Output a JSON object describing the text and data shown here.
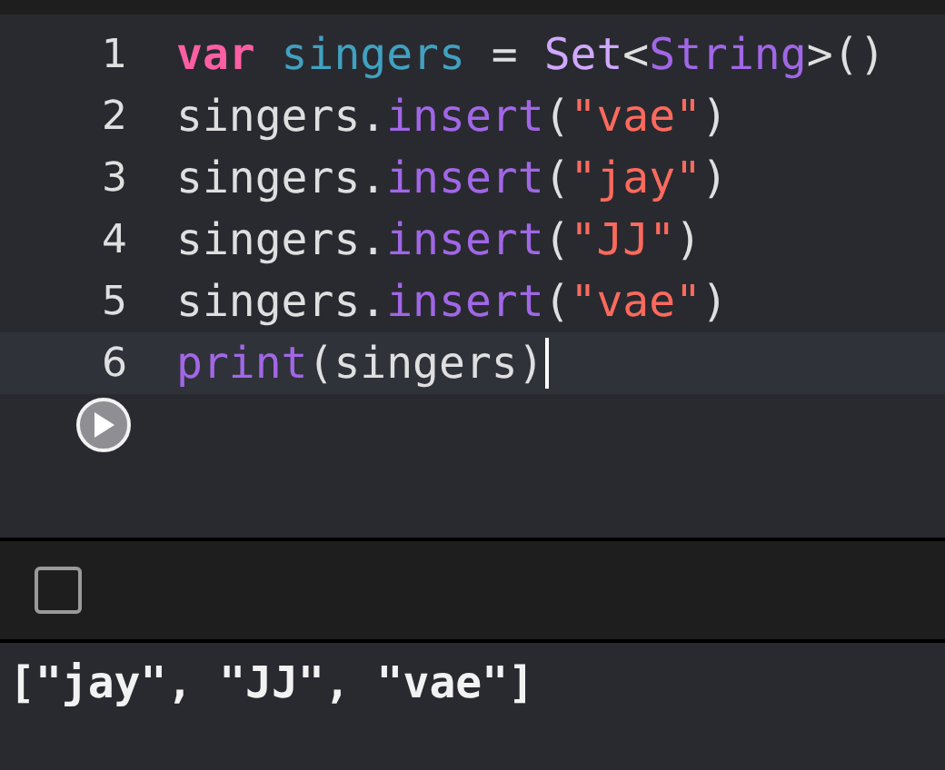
{
  "editor": {
    "lines": [
      {
        "number": "1",
        "selected": false,
        "tokens": [
          {
            "kind": "keyword",
            "text": "var "
          },
          {
            "kind": "declaration",
            "text": "singers"
          },
          {
            "kind": "plain",
            "text": " = "
          },
          {
            "kind": "type",
            "text": "Set"
          },
          {
            "kind": "plain",
            "text": "<"
          },
          {
            "kind": "system-type",
            "text": "String"
          },
          {
            "kind": "plain",
            "text": ">()"
          }
        ]
      },
      {
        "number": "2",
        "selected": false,
        "tokens": [
          {
            "kind": "plain",
            "text": "singers."
          },
          {
            "kind": "method",
            "text": "insert"
          },
          {
            "kind": "plain",
            "text": "("
          },
          {
            "kind": "string",
            "text": "\"vae\""
          },
          {
            "kind": "plain",
            "text": ")"
          }
        ]
      },
      {
        "number": "3",
        "selected": false,
        "tokens": [
          {
            "kind": "plain",
            "text": "singers."
          },
          {
            "kind": "method",
            "text": "insert"
          },
          {
            "kind": "plain",
            "text": "("
          },
          {
            "kind": "string",
            "text": "\"jay\""
          },
          {
            "kind": "plain",
            "text": ")"
          }
        ]
      },
      {
        "number": "4",
        "selected": false,
        "tokens": [
          {
            "kind": "plain",
            "text": "singers."
          },
          {
            "kind": "method",
            "text": "insert"
          },
          {
            "kind": "plain",
            "text": "("
          },
          {
            "kind": "string",
            "text": "\"JJ\""
          },
          {
            "kind": "plain",
            "text": ")"
          }
        ]
      },
      {
        "number": "5",
        "selected": false,
        "tokens": [
          {
            "kind": "plain",
            "text": "singers."
          },
          {
            "kind": "method",
            "text": "insert"
          },
          {
            "kind": "plain",
            "text": "("
          },
          {
            "kind": "string",
            "text": "\"vae\""
          },
          {
            "kind": "plain",
            "text": ")"
          }
        ]
      },
      {
        "number": "6",
        "selected": true,
        "tokens": [
          {
            "kind": "method",
            "text": "print"
          },
          {
            "kind": "plain",
            "text": "(singers)"
          }
        ]
      }
    ]
  },
  "console": {
    "output": "[\"jay\", \"JJ\", \"vae\"]"
  }
}
